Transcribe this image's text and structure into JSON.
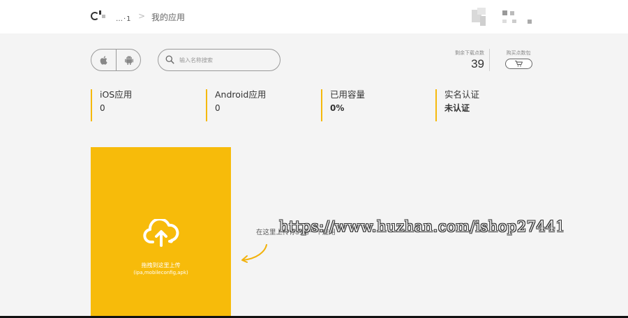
{
  "header": {
    "logo_dots": "…·1",
    "breadcrumb_sep": ">",
    "breadcrumb": "我的应用"
  },
  "platform_toggle": {
    "ios_icon": "apple-icon",
    "android_icon": "android-icon"
  },
  "search": {
    "placeholder": "输入名称搜索",
    "value": ""
  },
  "downloads": {
    "label": "剩余下载点数",
    "value": "39",
    "buy_label": "购买点数包",
    "buy_icon": "cart-icon"
  },
  "stats": [
    {
      "label": "iOS应用",
      "value": "0"
    },
    {
      "label": "Android应用",
      "value": "0"
    },
    {
      "label": "已用容量",
      "value": "0%"
    },
    {
      "label": "实名认证",
      "value": "未认证"
    }
  ],
  "upload": {
    "icon": "cloud-upload-icon",
    "drag_text": "拖拽到这里上传",
    "types": "(ipa,mobileconfig,apk)"
  },
  "hint": "在这里上传你的第一个应用",
  "watermark": "https://www.huzhan.com/ishop27441",
  "colors": {
    "accent": "#f7bb0a",
    "background": "#f4f4f4"
  }
}
